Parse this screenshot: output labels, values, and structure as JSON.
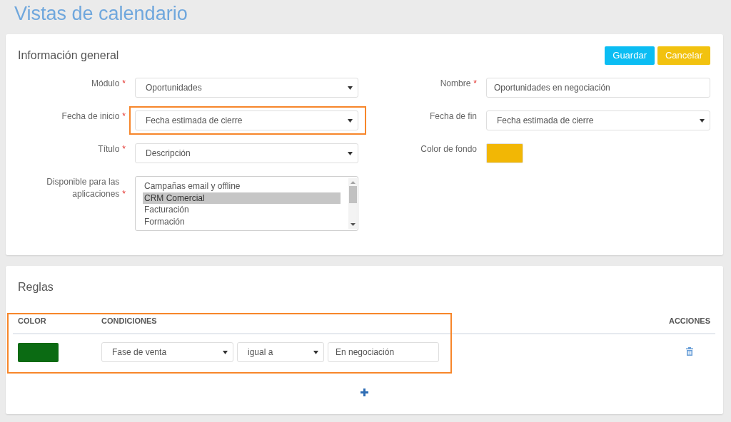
{
  "page": {
    "title": "Vistas de calendario"
  },
  "general": {
    "title": "Información general",
    "buttons": [
      {
        "label": "Guardar",
        "kind": "primary"
      },
      {
        "label": "Cancelar",
        "kind": "warning"
      }
    ],
    "columns": [
      {
        "fields": [
          {
            "label": "Módulo",
            "required_mark": "*",
            "kind": "select",
            "value": "Oportunidades",
            "highlighted": false
          },
          {
            "label": "Fecha de inicio",
            "required_mark": "*",
            "kind": "select",
            "value": "Fecha estimada de cierre",
            "highlighted": true
          },
          {
            "label": "Título",
            "required_mark": "*",
            "kind": "select",
            "value": "Descripción",
            "highlighted": false
          },
          {
            "label": "Disponible para las aplicaciones",
            "required_mark": "*",
            "kind": "listbox",
            "options": [
              {
                "label": "Campañas email y offline",
                "selected": false
              },
              {
                "label": "CRM Comercial",
                "selected": true
              },
              {
                "label": "Facturación",
                "selected": false
              },
              {
                "label": "Formación",
                "selected": false
              }
            ],
            "highlighted": false
          }
        ]
      },
      {
        "fields": [
          {
            "label": "Nombre",
            "required_mark": "*",
            "kind": "text",
            "value": "Oportunidades en negociación",
            "highlighted": false
          },
          {
            "label": "Fecha de fin",
            "kind": "select",
            "value": "Fecha estimada de cierre",
            "highlighted": false
          },
          {
            "label": "Color de fondo",
            "kind": "color",
            "color": "#f2b705",
            "highlighted": false
          }
        ]
      }
    ]
  },
  "rules": {
    "title": "Reglas",
    "highlighted": true,
    "columns": [
      "COLOR",
      "CONDICIONES",
      "ACCIONES"
    ],
    "rows": [
      {
        "color": "#0b6b13",
        "conditions": [
          {
            "kind": "select",
            "value": "Fase de venta"
          },
          {
            "kind": "select",
            "value": "igual a"
          },
          {
            "kind": "text",
            "value": "En negociación"
          }
        ]
      }
    ]
  }
}
